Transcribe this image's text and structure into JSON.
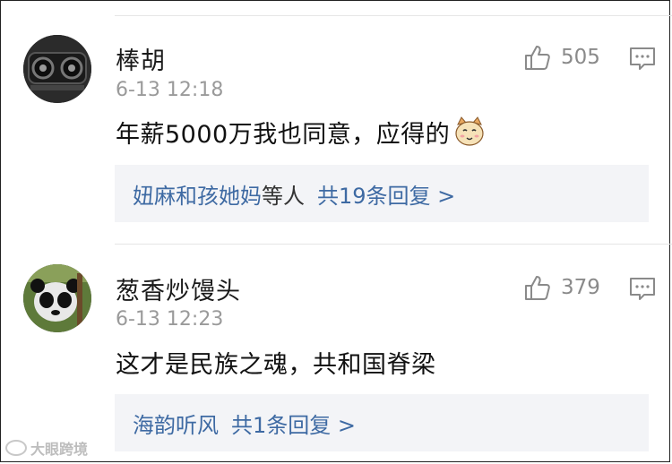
{
  "comments": [
    {
      "username": "棒胡",
      "time": "6-13 12:18",
      "content": "年薪5000万我也同意，应得的",
      "content_emoji": "cat-face-emoji",
      "likes": "505",
      "replies": {
        "names": "妞麻和孩她妈",
        "suffix": "等人",
        "link": "共19条回复 >"
      }
    },
    {
      "username": "葱香炒馒头",
      "time": "6-13 12:23",
      "content": "这才是民族之魂，共和国脊梁",
      "likes": "379",
      "replies": {
        "names": "海韵听风",
        "link": "共1条回复 >"
      }
    }
  ],
  "watermark": {
    "text": "大眼跨境"
  },
  "colors": {
    "link_blue": "#3e6aa3",
    "reply_bg": "#f3f4f7",
    "meta_gray": "#9a9a9a"
  }
}
